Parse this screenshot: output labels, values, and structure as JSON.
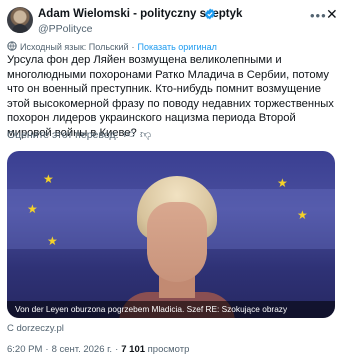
{
  "author": {
    "name": "Adam Wielomski - polityczny sceptyk",
    "handle": "@PPolityce",
    "verified_color": "#1d9bf0"
  },
  "header_icons": {
    "more": "more-icon",
    "close": "close-icon"
  },
  "translation": {
    "source_label": "Исходный язык: Польский",
    "show_original": "Показать оригинал"
  },
  "post": {
    "text": "Урсула фон дер Ляйен возмущена великолепными и многолюдными похоронами Ратко Младича в Сербии, потому что он военный преступник. Кто-нибудь помнит возмущение этой высокомерной фразу по поводу недавних торжественных похорон лидеров украинского нацизма периода Второй мировой войны в Киеве?"
  },
  "rate_translation": {
    "label": "Оцените этот перевод:"
  },
  "media": {
    "caption": "Von der Leyen oburzona pogrzebem Mladicia. Szef RE: Szokujące obrazy"
  },
  "source": "С dorzeczy.pl",
  "meta": {
    "time": "6:20 PM",
    "date": "8 сент. 2026 г.",
    "views_count": "7 101",
    "views_label": "просмотр"
  },
  "colors": {
    "accent": "#1d9bf0",
    "secondary_text": "#536471",
    "primary_text": "#0f1419"
  }
}
